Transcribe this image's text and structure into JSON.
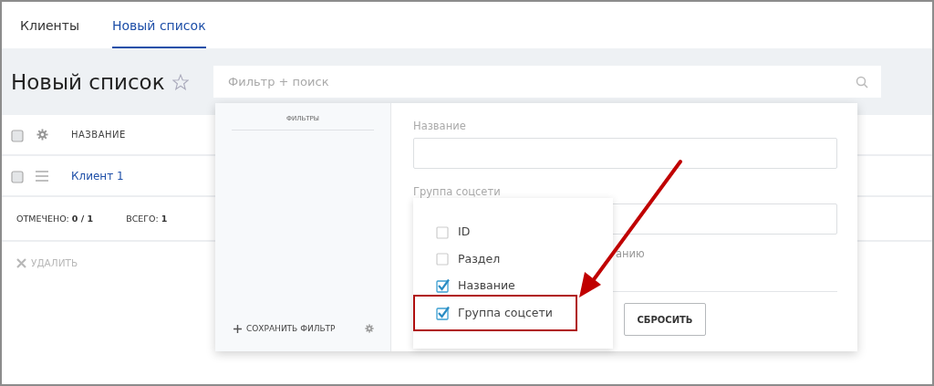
{
  "tabs": [
    {
      "label": "Клиенты",
      "selected": false
    },
    {
      "label": "Новый список",
      "selected": true
    }
  ],
  "page_title": "Новый список",
  "search": {
    "placeholder": "Фильтр + поиск"
  },
  "table": {
    "header_checked": false,
    "columns": [
      "НАЗВАНИЕ"
    ],
    "rows": [
      {
        "name": "Клиент 1",
        "checked": false
      }
    ],
    "footer": [
      "ОТМЕЧЕНО: **0 / 1**",
      "ВСЕГО: **1**"
    ]
  },
  "delete_action": {
    "label": "УДАЛИТЬ",
    "disabled": true
  },
  "filter_panel": {
    "sidebar_title": "ФИЛЬТРЫ",
    "save_filter": "СОХРАНИТЬ ФИЛЬТР",
    "fields": [
      {
        "label": "Название"
      },
      {
        "label": "Группа соцсети"
      }
    ],
    "partial_text": "анию",
    "reset_button": "СБРОСИТЬ"
  },
  "field_menu": {
    "items": [
      {
        "label": "ID",
        "checked": false,
        "highlighted": false
      },
      {
        "label": "Раздел",
        "checked": false,
        "highlighted": false
      },
      {
        "label": "Название",
        "checked": true,
        "highlighted": false
      },
      {
        "label": "Группа соцсети",
        "checked": true,
        "highlighted": true
      }
    ]
  }
}
